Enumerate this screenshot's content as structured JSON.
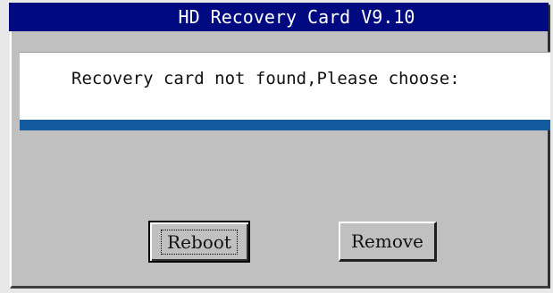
{
  "window": {
    "title": "HD Recovery Card V9.10"
  },
  "message": {
    "text": "Recovery card not found,Please choose:"
  },
  "buttons": {
    "reboot_label": "Reboot",
    "remove_label": "Remove"
  },
  "colors": {
    "titlebar": "#000a80",
    "dialog_face": "#c0c0c0",
    "message_bg": "#ffffff",
    "accent_bar": "#135a9e"
  }
}
